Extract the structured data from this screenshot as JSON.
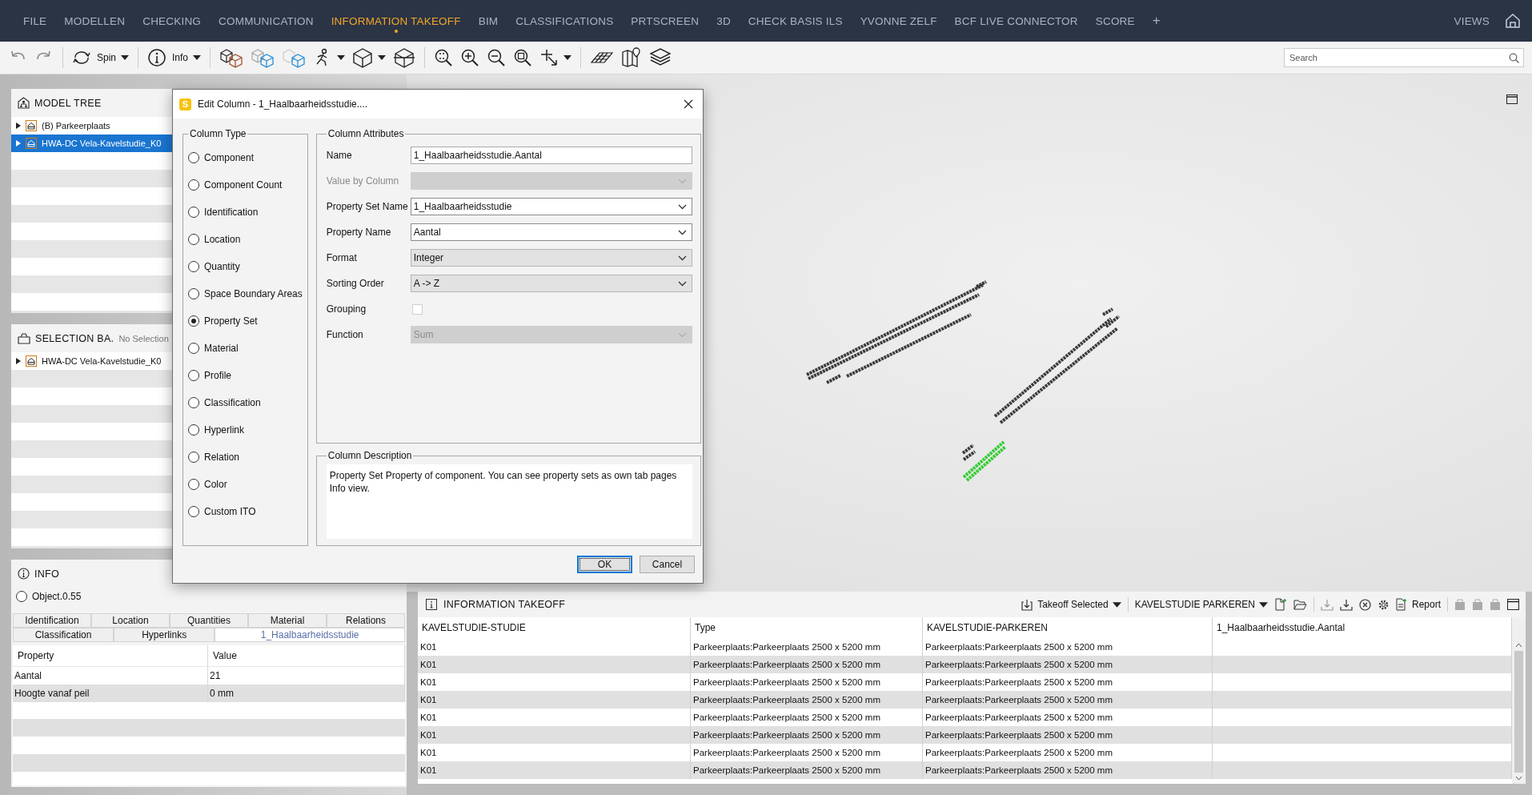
{
  "menu": {
    "items": [
      {
        "label": "FILE",
        "selected": false
      },
      {
        "label": "MODELLEN",
        "selected": false
      },
      {
        "label": "CHECKING",
        "selected": false
      },
      {
        "label": "COMMUNICATION",
        "selected": false
      },
      {
        "label": "INFORMATION TAKEOFF",
        "selected": true
      },
      {
        "label": "BIM",
        "selected": false
      },
      {
        "label": "CLASSIFICATIONS",
        "selected": false
      },
      {
        "label": "PRTSCREEN",
        "selected": false
      },
      {
        "label": "3D",
        "selected": false
      },
      {
        "label": "CHECK BASIS ILS",
        "selected": false
      },
      {
        "label": "YVONNE ZELF",
        "selected": false
      },
      {
        "label": "BCF LIVE CONNECTOR",
        "selected": false
      },
      {
        "label": "SCORE",
        "selected": false
      }
    ],
    "add_tab": "+",
    "views": "VIEWS"
  },
  "toolbar": {
    "spin": "Spin",
    "info": "Info",
    "search": {
      "placeholder": "Search"
    }
  },
  "model_tree": {
    "title": "MODEL TREE",
    "items": [
      {
        "label": "(B) Parkeerplaats",
        "selected": false
      },
      {
        "label": "HWA-DC Vela-Kavelstudie_K0",
        "selected": true
      }
    ]
  },
  "selection_basket": {
    "title": "SELECTION BA.",
    "status": "No Selection",
    "items": [
      {
        "label": "HWA-DC Vela-Kavelstudie_K0",
        "selected": false
      }
    ]
  },
  "info": {
    "title": "INFO",
    "object": {
      "label": "Object.0.55",
      "checked": false
    },
    "tab_rows": [
      [
        {
          "label": "Identification",
          "selected": false
        },
        {
          "label": "Location",
          "selected": false
        },
        {
          "label": "Quantities",
          "selected": false
        },
        {
          "label": "Material",
          "selected": false
        },
        {
          "label": "Relations",
          "selected": false
        }
      ],
      [
        {
          "label": "Classification",
          "selected": false
        },
        {
          "label": "Hyperlinks",
          "selected": false
        },
        {
          "label": "1_Haalbaarheidsstudie",
          "selected": true
        }
      ]
    ],
    "table": {
      "columns": [
        "Property",
        "Value"
      ],
      "rows": [
        [
          "Aantal",
          "21"
        ],
        [
          "Hoogte vanaf peil",
          "0 mm"
        ]
      ]
    }
  },
  "information_takeoff": {
    "title": "INFORMATION TAKEOFF",
    "takeoff_mode": "Takeoff Selected",
    "template": "KAVELSTUDIE PARKEREN",
    "report": "Report",
    "table": {
      "columns": [
        "KAVELSTUDIE-STUDIE",
        "Type",
        "KAVELSTUDIE-PARKEREN",
        "1_Haalbaarheidsstudie.Aantal"
      ],
      "rows": [
        [
          "K01",
          "Parkeerplaats:Parkeerplaats 2500 x 5200 mm",
          "Parkeerplaats:Parkeerplaats 2500 x 5200 mm"
        ],
        [
          "K01",
          "Parkeerplaats:Parkeerplaats 2500 x 5200 mm",
          "Parkeerplaats:Parkeerplaats 2500 x 5200 mm"
        ],
        [
          "K01",
          "Parkeerplaats:Parkeerplaats 2500 x 5200 mm",
          "Parkeerplaats:Parkeerplaats 2500 x 5200 mm"
        ],
        [
          "K01",
          "Parkeerplaats:Parkeerplaats 2500 x 5200 mm",
          "Parkeerplaats:Parkeerplaats 2500 x 5200 mm"
        ],
        [
          "K01",
          "Parkeerplaats:Parkeerplaats 2500 x 5200 mm",
          "Parkeerplaats:Parkeerplaats 2500 x 5200 mm"
        ],
        [
          "K01",
          "Parkeerplaats:Parkeerplaats 2500 x 5200 mm",
          "Parkeerplaats:Parkeerplaats 2500 x 5200 mm"
        ],
        [
          "K01",
          "Parkeerplaats:Parkeerplaats 2500 x 5200 mm",
          "Parkeerplaats:Parkeerplaats 2500 x 5200 mm"
        ],
        [
          "K01",
          "Parkeerplaats:Parkeerplaats 2500 x 5200 mm",
          "Parkeerplaats:Parkeerplaats 2500 x 5200 mm"
        ]
      ]
    }
  },
  "dialog": {
    "app_icon_letter": "S",
    "title": "Edit Column - 1_Haalbaarheidsstudie....",
    "column_type": {
      "title": "Column Type",
      "options": [
        {
          "label": "Component",
          "selected": false
        },
        {
          "label": "Component Count",
          "selected": false
        },
        {
          "label": "Identification",
          "selected": false
        },
        {
          "label": "Location",
          "selected": false
        },
        {
          "label": "Quantity",
          "selected": false
        },
        {
          "label": "Space Boundary Areas",
          "selected": false
        },
        {
          "label": "Property Set",
          "selected": true
        },
        {
          "label": "Material",
          "selected": false
        },
        {
          "label": "Profile",
          "selected": false
        },
        {
          "label": "Classification",
          "selected": false
        },
        {
          "label": "Hyperlink",
          "selected": false
        },
        {
          "label": "Relation",
          "selected": false
        },
        {
          "label": "Color",
          "selected": false
        },
        {
          "label": "Custom ITO",
          "selected": false
        }
      ]
    },
    "attributes": {
      "title": "Column Attributes",
      "fields": [
        {
          "label": "Name",
          "kind": "text",
          "value": "1_Haalbaarheidsstudie.Aantal",
          "disabled": false,
          "label_disabled": false
        },
        {
          "label": "Value by Column",
          "kind": "combo",
          "disabled": true,
          "label_disabled": true
        },
        {
          "label": "Property Set Name",
          "kind": "combo",
          "value": "1_Haalbaarheidsstudie",
          "disabled": false,
          "label_disabled": false
        },
        {
          "label": "Property Name",
          "kind": "combo",
          "value": "Aantal",
          "disabled": false,
          "label_disabled": false
        },
        {
          "label": "Format",
          "kind": "select",
          "value": "Integer",
          "disabled": false,
          "label_disabled": false
        },
        {
          "label": "Sorting Order",
          "kind": "select",
          "value": "A -> Z",
          "disabled": false,
          "label_disabled": false
        },
        {
          "label": "Grouping",
          "kind": "checkbox",
          "checked": false,
          "disabled": false,
          "label_disabled": false
        },
        {
          "label": "Function",
          "kind": "select",
          "value": "Sum",
          "disabled": true,
          "label_disabled": false
        }
      ]
    },
    "description": {
      "title": "Column Description",
      "text": "Property Set Property of component. You can see property sets as own tab pages Info view."
    },
    "buttons": [
      {
        "label": "OK",
        "default": true
      },
      {
        "label": "Cancel",
        "default": false
      }
    ]
  }
}
